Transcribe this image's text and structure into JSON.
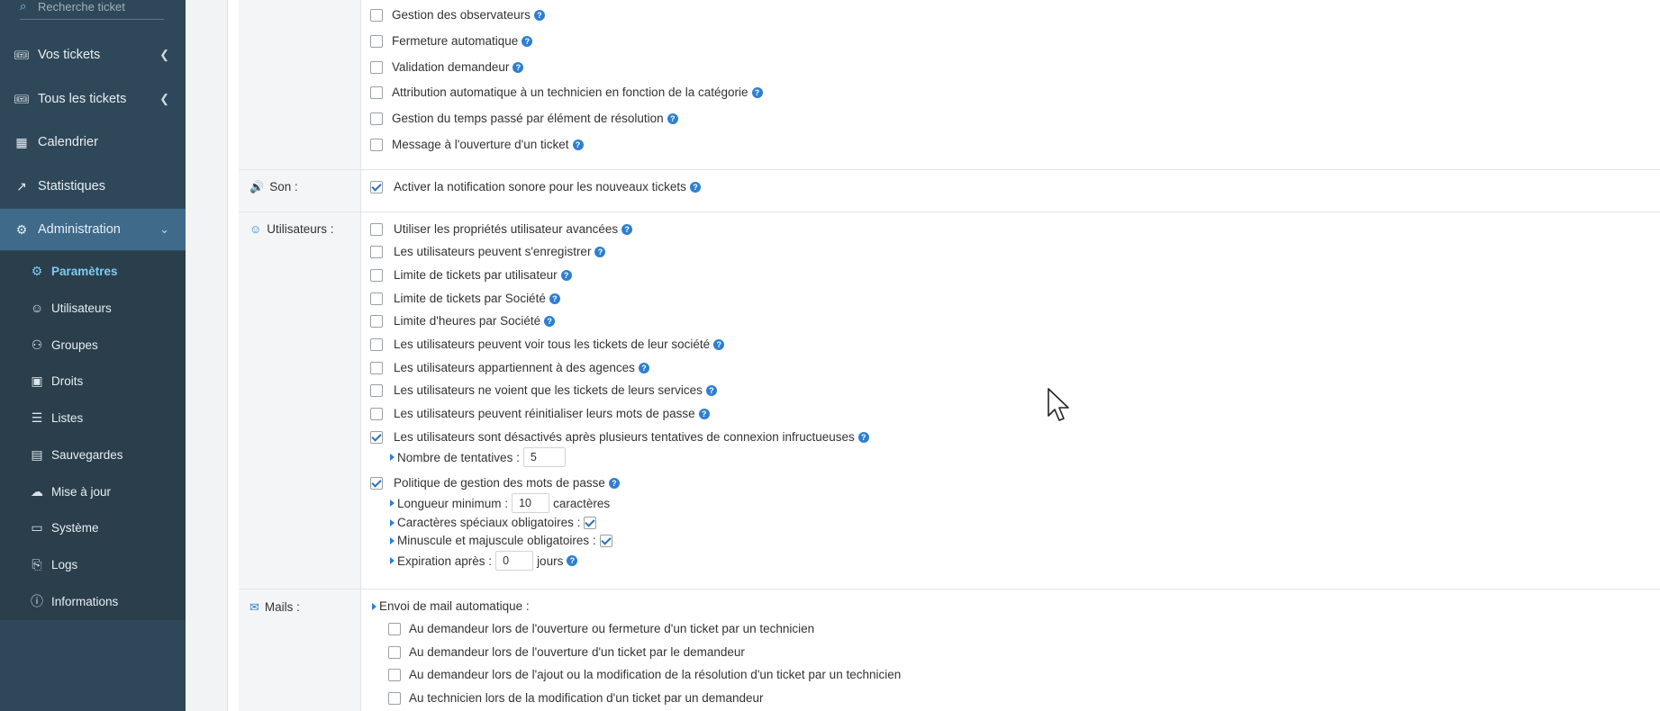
{
  "sidebar": {
    "search_placeholder": "Recherche ticket",
    "nav": [
      {
        "label": "Vos tickets",
        "icon": "ticket-icon"
      },
      {
        "label": "Tous les tickets",
        "icon": "ticket-icon"
      },
      {
        "label": "Calendrier",
        "icon": "calendar-icon"
      },
      {
        "label": "Statistiques",
        "icon": "chart-icon"
      },
      {
        "label": "Administration",
        "icon": "cogs-icon"
      }
    ],
    "sub": [
      {
        "label": "Paramètres",
        "icon": "gear-icon"
      },
      {
        "label": "Utilisateurs",
        "icon": "user-icon"
      },
      {
        "label": "Groupes",
        "icon": "users-icon"
      },
      {
        "label": "Droits",
        "icon": "lock-icon"
      },
      {
        "label": "Listes",
        "icon": "list-icon"
      },
      {
        "label": "Sauvegardes",
        "icon": "save-icon"
      },
      {
        "label": "Mise à jour",
        "icon": "cloud-upload-icon"
      },
      {
        "label": "Système",
        "icon": "desktop-icon"
      },
      {
        "label": "Logs",
        "icon": "clipboard-icon"
      },
      {
        "label": "Informations",
        "icon": "info-icon"
      }
    ]
  },
  "top_options": [
    {
      "label": "Gestion des observateurs",
      "checked": false
    },
    {
      "label": "Fermeture automatique",
      "checked": false
    },
    {
      "label": "Validation demandeur",
      "checked": false
    },
    {
      "label": "Attribution automatique à un technicien en fonction de la catégorie",
      "checked": false
    },
    {
      "label": "Gestion du temps passé par élément de résolution",
      "checked": false
    },
    {
      "label": "Message à l'ouverture d'un ticket",
      "checked": false
    }
  ],
  "son": {
    "label": "Son :",
    "option": "Activer la notification sonore pour les nouveaux tickets",
    "checked": true
  },
  "utilisateurs": {
    "label": "Utilisateurs :",
    "options": [
      {
        "label": "Utiliser les propriétés utilisateur avancées",
        "checked": false
      },
      {
        "label": "Les utilisateurs peuvent s'enregistrer",
        "checked": false
      },
      {
        "label": "Limite de tickets par utilisateur",
        "checked": false
      },
      {
        "label": "Limite de tickets par Société",
        "checked": false
      },
      {
        "label": "Limite d'heures par Société",
        "checked": false
      },
      {
        "label": "Les utilisateurs peuvent voir tous les tickets de leur société",
        "checked": false
      },
      {
        "label": "Les utilisateurs appartiennent à des agences",
        "checked": false
      },
      {
        "label": "Les utilisateurs ne voient que les tickets de leurs services",
        "checked": false
      },
      {
        "label": "Les utilisateurs peuvent réinitialiser leurs mots de passe",
        "checked": false
      },
      {
        "label": "Les utilisateurs sont désactivés après plusieurs tentatives de connexion infructueuses",
        "checked": true
      }
    ],
    "tentatives_label": "Nombre de tentatives :",
    "tentatives_value": "5",
    "password_policy": {
      "label": "Politique de gestion des mots de passe",
      "checked": true
    },
    "longueur_label": "Longueur minimum :",
    "longueur_value": "10",
    "longueur_unit": "caractères",
    "speciaux_label": "Caractères spéciaux obligatoires :",
    "speciaux_checked": true,
    "casse_label": "Minuscule et majuscule obligatoires :",
    "casse_checked": true,
    "expiration_label": "Expiration après :",
    "expiration_value": "0",
    "expiration_unit": "jours"
  },
  "mails": {
    "label": "Mails :",
    "auto_label": "Envoi de mail automatique :",
    "options": [
      {
        "label": "Au demandeur lors de l'ouverture ou fermeture d'un ticket par un technicien",
        "checked": false
      },
      {
        "label": "Au demandeur lors de l'ouverture d'un ticket par le demandeur",
        "checked": false
      },
      {
        "label": "Au demandeur lors de l'ajout ou la modification de la résolution d'un ticket par un technicien",
        "checked": false
      },
      {
        "label": "Au technicien lors de la modification d'un ticket par un demandeur",
        "checked": false
      }
    ]
  },
  "help_glyph": "?"
}
